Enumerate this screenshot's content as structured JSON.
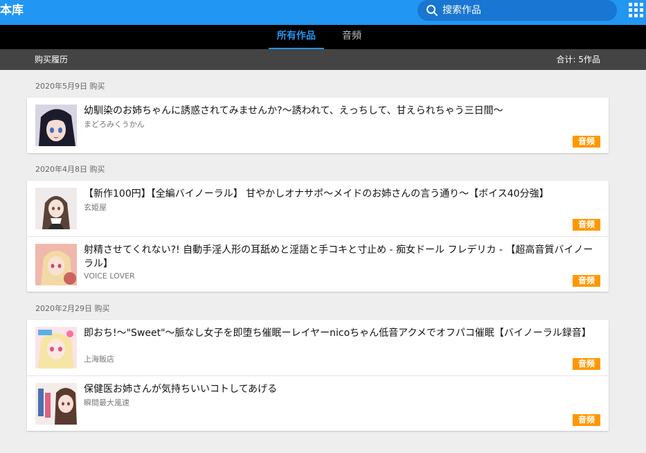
{
  "header": {
    "title": "本库",
    "search_placeholder": "搜索作品"
  },
  "tabs": [
    {
      "label": "所有作品",
      "active": true
    },
    {
      "label": "音頻",
      "active": false
    }
  ],
  "info": {
    "left": "购买履历",
    "right": "合计: 5作品"
  },
  "groups": [
    {
      "date": "2020年5月9日 购买",
      "items": [
        {
          "title": "幼馴染のお姉ちゃんに誘惑されてみませんか?～誘われて、えっちして、甘えられちゃう三日間～",
          "author": "まどろみくうかん",
          "badge": "音频"
        }
      ]
    },
    {
      "date": "2020年4月8日 购买",
      "items": [
        {
          "title": "【新作100円】【全編バイノーラル】 甘やかしオナサポ～メイドのお姉さんの言う通り～【ボイス40分強】",
          "author": "玄姫屋",
          "badge": "音频"
        },
        {
          "title": "射精させてくれない?! 自動手淫人形の耳舐めと淫語と手コキと寸止め - 痴女ドール フレデリカ - 【超高音質バイノーラル】",
          "author": "VOICE LOVER",
          "badge": "音频"
        }
      ]
    },
    {
      "date": "2020年2月29日 购买",
      "items": [
        {
          "title": "即おち!～\"Sweet\"～脈なし女子を即堕ち催眠ーレイヤーnicoちゃん低音アクメでオフパコ催眠【バイノーラル録音】",
          "author": "上海飯店",
          "badge": "音频"
        },
        {
          "title": "保健医お姉さんが気持ちいいコトしてあげる",
          "author": "瞬間最大風速",
          "badge": "音频"
        }
      ]
    }
  ],
  "colors": {
    "header_bg": "#2196f3",
    "tab_active": "#2196f3",
    "badge_bg": "#ff9800"
  },
  "icons": {
    "search": "search-icon",
    "apps": "apps-grid-icon"
  }
}
